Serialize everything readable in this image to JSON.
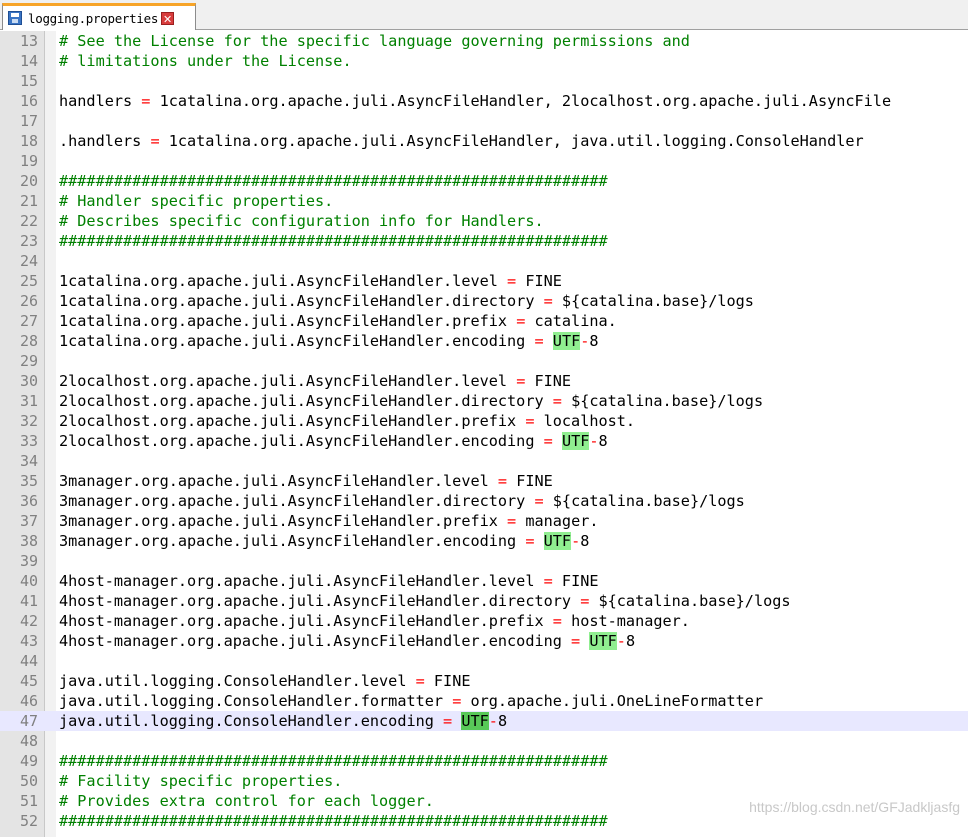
{
  "tab": {
    "label": "logging.properties",
    "save_icon": "save-icon",
    "close_icon": "close-icon"
  },
  "current_line": 47,
  "highlight_token": "UTF",
  "colors": {
    "comment": "#008000",
    "operator": "#ff0000",
    "highlight": "#90ee90",
    "current_line": "#e8e8ff"
  },
  "lines": [
    {
      "n": "13",
      "text": "# See the License for the specific language governing permissions and"
    },
    {
      "n": "14",
      "text": "# limitations under the License."
    },
    {
      "n": "15",
      "text": ""
    },
    {
      "n": "16",
      "text": "handlers = 1catalina.org.apache.juli.AsyncFileHandler, 2localhost.org.apache.juli.AsyncFile"
    },
    {
      "n": "17",
      "text": ""
    },
    {
      "n": "18",
      "text": ".handlers = 1catalina.org.apache.juli.AsyncFileHandler, java.util.logging.ConsoleHandler"
    },
    {
      "n": "19",
      "text": ""
    },
    {
      "n": "20",
      "text": "############################################################"
    },
    {
      "n": "21",
      "text": "# Handler specific properties."
    },
    {
      "n": "22",
      "text": "# Describes specific configuration info for Handlers."
    },
    {
      "n": "23",
      "text": "############################################################"
    },
    {
      "n": "24",
      "text": ""
    },
    {
      "n": "25",
      "text": "1catalina.org.apache.juli.AsyncFileHandler.level = FINE"
    },
    {
      "n": "26",
      "text": "1catalina.org.apache.juli.AsyncFileHandler.directory = ${catalina.base}/logs"
    },
    {
      "n": "27",
      "text": "1catalina.org.apache.juli.AsyncFileHandler.prefix = catalina."
    },
    {
      "n": "28",
      "text": "1catalina.org.apache.juli.AsyncFileHandler.encoding = UTF-8"
    },
    {
      "n": "29",
      "text": ""
    },
    {
      "n": "30",
      "text": "2localhost.org.apache.juli.AsyncFileHandler.level = FINE"
    },
    {
      "n": "31",
      "text": "2localhost.org.apache.juli.AsyncFileHandler.directory = ${catalina.base}/logs"
    },
    {
      "n": "32",
      "text": "2localhost.org.apache.juli.AsyncFileHandler.prefix = localhost."
    },
    {
      "n": "33",
      "text": "2localhost.org.apache.juli.AsyncFileHandler.encoding = UTF-8"
    },
    {
      "n": "34",
      "text": ""
    },
    {
      "n": "35",
      "text": "3manager.org.apache.juli.AsyncFileHandler.level = FINE"
    },
    {
      "n": "36",
      "text": "3manager.org.apache.juli.AsyncFileHandler.directory = ${catalina.base}/logs"
    },
    {
      "n": "37",
      "text": "3manager.org.apache.juli.AsyncFileHandler.prefix = manager."
    },
    {
      "n": "38",
      "text": "3manager.org.apache.juli.AsyncFileHandler.encoding = UTF-8"
    },
    {
      "n": "39",
      "text": ""
    },
    {
      "n": "40",
      "text": "4host-manager.org.apache.juli.AsyncFileHandler.level = FINE"
    },
    {
      "n": "41",
      "text": "4host-manager.org.apache.juli.AsyncFileHandler.directory = ${catalina.base}/logs"
    },
    {
      "n": "42",
      "text": "4host-manager.org.apache.juli.AsyncFileHandler.prefix = host-manager."
    },
    {
      "n": "43",
      "text": "4host-manager.org.apache.juli.AsyncFileHandler.encoding = UTF-8"
    },
    {
      "n": "44",
      "text": ""
    },
    {
      "n": "45",
      "text": "java.util.logging.ConsoleHandler.level = FINE"
    },
    {
      "n": "46",
      "text": "java.util.logging.ConsoleHandler.formatter = org.apache.juli.OneLineFormatter"
    },
    {
      "n": "47",
      "text": "java.util.logging.ConsoleHandler.encoding = UTF-8"
    },
    {
      "n": "48",
      "text": ""
    },
    {
      "n": "49",
      "text": "############################################################"
    },
    {
      "n": "50",
      "text": "# Facility specific properties."
    },
    {
      "n": "51",
      "text": "# Provides extra control for each logger."
    },
    {
      "n": "52",
      "text": "############################################################"
    }
  ],
  "watermark": "https://blog.csdn.net/GFJadkljasfg"
}
